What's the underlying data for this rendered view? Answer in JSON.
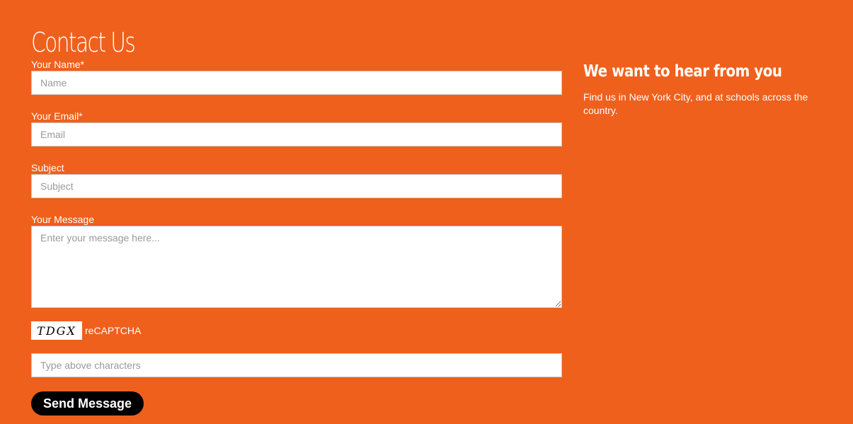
{
  "page": {
    "title": "Contact Us",
    "background_color": "#ef601c"
  },
  "form": {
    "name": {
      "label": "Your Name*",
      "placeholder": "Name",
      "value": ""
    },
    "email": {
      "label": "Your Email*",
      "placeholder": "Email",
      "value": ""
    },
    "subject": {
      "label": "Subject",
      "placeholder": "Subject",
      "value": ""
    },
    "message": {
      "label": "Your Message",
      "placeholder": "Enter your message here...",
      "value": ""
    },
    "captcha": {
      "image_text": "TDGX",
      "label": "reCAPTCHA",
      "placeholder": "Type above characters",
      "value": ""
    },
    "submit_label": "Send Message",
    "submit_color": "#000000"
  },
  "aside": {
    "heading": "We want to hear from you",
    "text": "Find us in New York City, and at schools across the country."
  }
}
